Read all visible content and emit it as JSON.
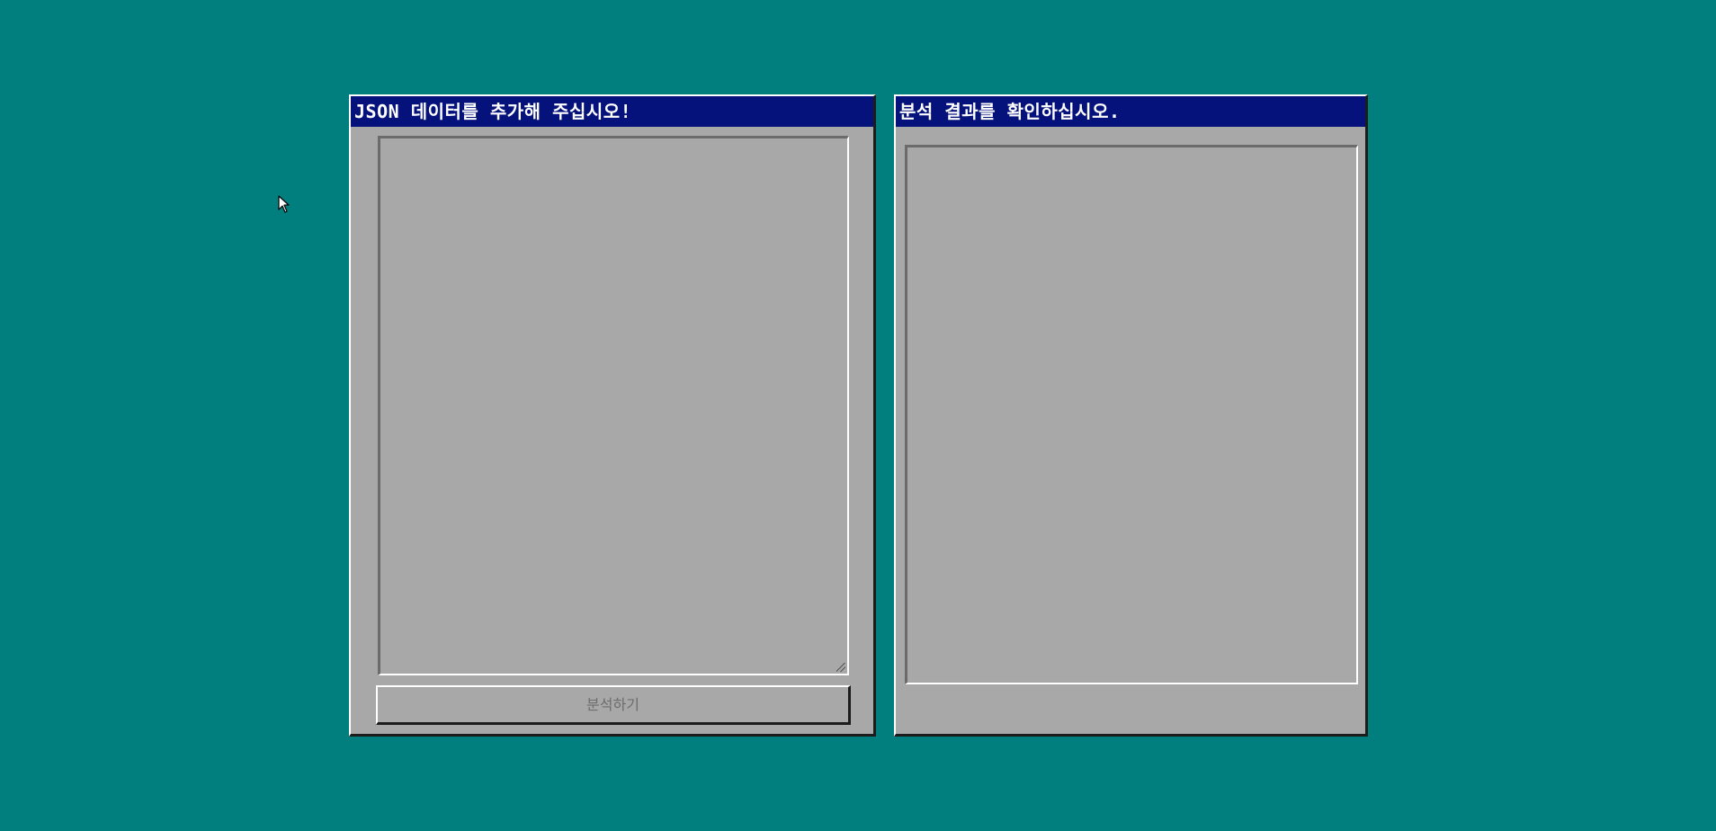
{
  "theme": {
    "desktop_color": "#017f7e",
    "titlebar_color": "#06127c",
    "window_color": "#a8a8a8"
  },
  "input_window": {
    "title": "JSON 데이터를 추가해 주십시오!",
    "textarea_value": "",
    "analyze_button_label": "분석하기",
    "analyze_button_disabled": true
  },
  "result_window": {
    "title": "분석 결과를 확인하십시오.",
    "result_text": ""
  },
  "cursor": {
    "icon": "arrow-pointer-icon"
  }
}
